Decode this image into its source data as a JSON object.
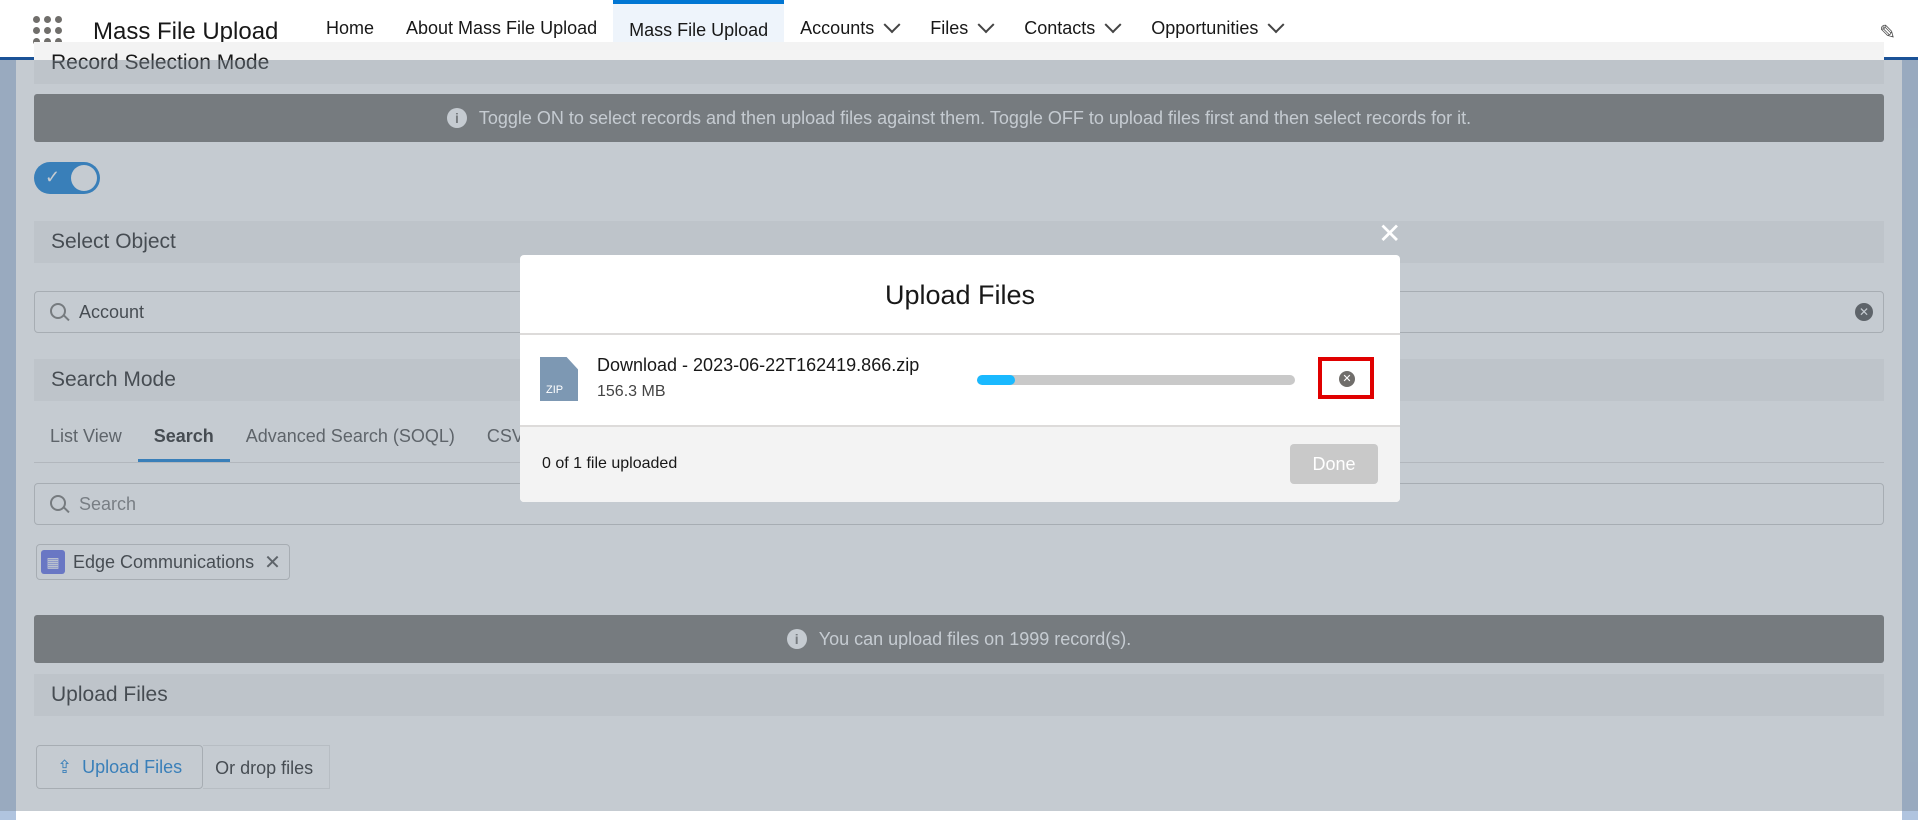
{
  "app": {
    "name": "Mass File Upload"
  },
  "nav": {
    "items": [
      {
        "label": "Home",
        "dropdown": false,
        "active": false
      },
      {
        "label": "About Mass File Upload",
        "dropdown": false,
        "active": false
      },
      {
        "label": "Mass File Upload",
        "dropdown": false,
        "active": true
      },
      {
        "label": "Accounts",
        "dropdown": true,
        "active": false
      },
      {
        "label": "Files",
        "dropdown": true,
        "active": false
      },
      {
        "label": "Contacts",
        "dropdown": true,
        "active": false
      },
      {
        "label": "Opportunities",
        "dropdown": true,
        "active": false
      }
    ]
  },
  "page": {
    "record_selection_mode": "Record Selection Mode",
    "toggle_info": "Toggle ON to select records and then upload files against them. Toggle OFF to upload files first and then select records for it.",
    "toggle_on": true,
    "select_object": "Select Object",
    "object_value": "Account",
    "search_mode": "Search Mode",
    "tabs": [
      "List View",
      "Search",
      "Advanced Search (SOQL)",
      "CSV"
    ],
    "active_tab": "Search",
    "search_placeholder": "Search",
    "selected_record": "Edge Communications",
    "record_limit_info": "You can upload files on 1999 record(s).",
    "upload_files_section": "Upload Files",
    "upload_button": "Upload Files",
    "drop_text": "Or drop files"
  },
  "modal": {
    "title": "Upload Files",
    "close_glyph": "✕",
    "file": {
      "name": "Download - 2023-06-22T162419.866.zip",
      "size": "156.3 MB",
      "type_label": "ZIP",
      "progress": 0.12
    },
    "footer_text": "0 of 1 file uploaded",
    "done_label": "Done"
  },
  "colors": {
    "brand": "#0176d3",
    "progress": "#1ab9ff",
    "highlight": "#e00000"
  }
}
